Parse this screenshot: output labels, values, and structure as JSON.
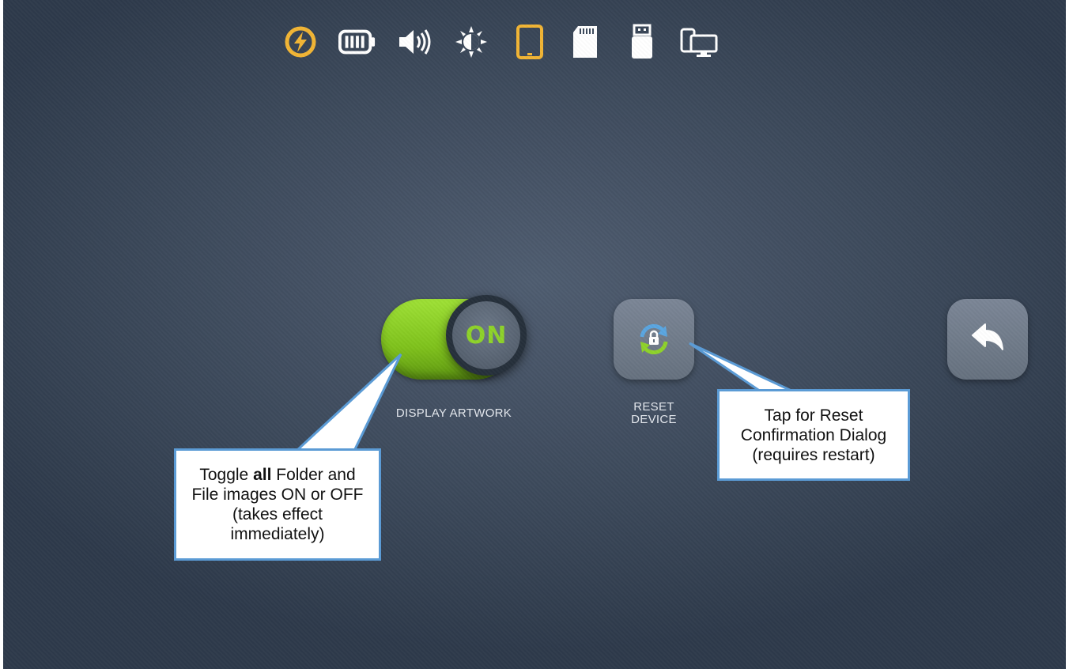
{
  "status_bar": {
    "icons": [
      {
        "name": "charging-bolt-icon",
        "color": "#f2b534"
      },
      {
        "name": "battery-icon",
        "color": "#ffffff"
      },
      {
        "name": "volume-icon",
        "color": "#ffffff"
      },
      {
        "name": "brightness-icon",
        "color": "#ffffff"
      },
      {
        "name": "tablet-icon",
        "color": "#f2b534"
      },
      {
        "name": "sd-card-icon",
        "color": "#ffffff"
      },
      {
        "name": "usb-drive-icon",
        "color": "#ffffff"
      },
      {
        "name": "multi-screen-icon",
        "color": "#ffffff"
      }
    ]
  },
  "controls": {
    "display_artwork": {
      "label": "DISPLAY ARTWORK",
      "state": "ON",
      "accent": "#8ed22a"
    },
    "reset_device": {
      "label_line1": "RESET",
      "label_line2": "DEVICE"
    },
    "back_button": {
      "icon": "back-arrow-icon"
    }
  },
  "callouts": {
    "toggle_note": {
      "line1_pre": "Toggle ",
      "line1_bold": "all",
      "line1_post": " Folder and",
      "line2": "File images ON or OFF",
      "line3": "(takes effect",
      "line4": "immediately)"
    },
    "reset_note": {
      "line1": "Tap for Reset",
      "line2": "Confirmation Dialog",
      "line3": "(requires restart)"
    }
  },
  "colors": {
    "background": "#3d4a5c",
    "callout_border": "#5b9bd5",
    "icon_accent": "#f2b534"
  }
}
